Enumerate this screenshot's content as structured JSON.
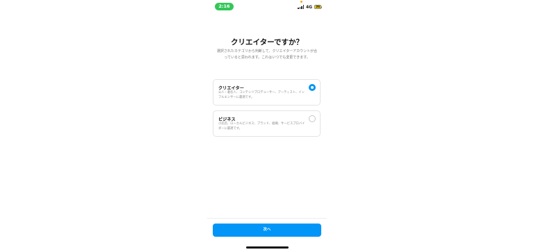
{
  "status_bar": {
    "time": "2:16",
    "network": "4G",
    "battery": "36"
  },
  "page": {
    "title": "クリエイターですか？",
    "subtitle": "選択されたカテゴリから判断して、クリエイターアカウントが合っていると思われます。これはいつでも変更できます。"
  },
  "options": [
    {
      "title": "クリエイター",
      "description": "公人・著名人、コンテンツプロデューサー、アーティスト、インフルエンサーに最適です。",
      "selected": true
    },
    {
      "title": "ビジネス",
      "description": "小売店、ローカルビジネス、ブランド、組織、サービスプロバイダーに最適です。",
      "selected": false
    }
  ],
  "footer": {
    "next_label": "次へ"
  },
  "colors": {
    "accent": "#0095f6",
    "time_pill": "#34c759"
  }
}
